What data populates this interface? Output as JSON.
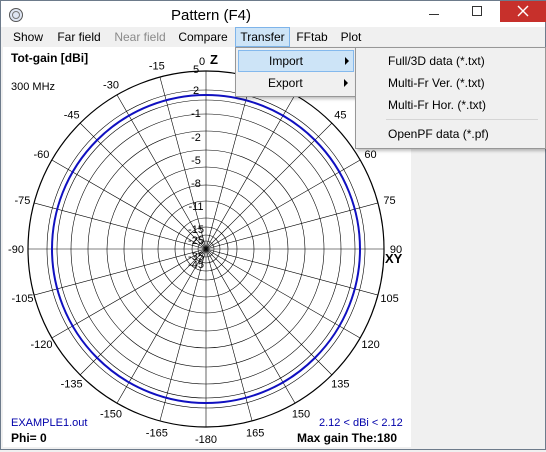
{
  "window": {
    "title": "Pattern    (F4)"
  },
  "menubar": {
    "items": [
      {
        "label": "Show"
      },
      {
        "label": "Far field"
      },
      {
        "label": "Near field"
      },
      {
        "label": "Compare"
      },
      {
        "label": "Transfer"
      },
      {
        "label": "FFtab"
      },
      {
        "label": "Plot"
      }
    ]
  },
  "transfer_menu": {
    "items": [
      {
        "label": "Import"
      },
      {
        "label": "Export"
      }
    ]
  },
  "import_submenu": {
    "items": [
      {
        "label": "Full/3D data (*.txt)"
      },
      {
        "label": "Multi-Fr Ver. (*.txt)"
      },
      {
        "label": "Multi-Fr Hor. (*.txt)"
      },
      {
        "label": "OpenPF data (*.pf)"
      }
    ]
  },
  "plot": {
    "quantity_label": "Tot-gain [dBi]",
    "frequency": "300 MHz",
    "axis_z": "Z",
    "axis_xy": "XY",
    "file_name": "EXAMPLE1.out",
    "phi": "Phi= 0",
    "gain_range": "2.12 < dBi < 2.12",
    "max_gain": "Max gain The:180",
    "radial_ticks": [
      "5",
      "2",
      "-1",
      "-2",
      "-5",
      "-8",
      "-11",
      "-15",
      "-25",
      "-35",
      "-45"
    ],
    "angle_labels": [
      "0",
      "-15",
      "15",
      "-30",
      "30",
      "-45",
      "45",
      "-60",
      "60",
      "-75",
      "75",
      "-90",
      "90",
      "-105",
      "105",
      "-120",
      "120",
      "-135",
      "135",
      "-150",
      "150",
      "-165",
      "165",
      "-180"
    ],
    "pattern_color": "#1010c0",
    "grid_color": "#000000"
  }
}
